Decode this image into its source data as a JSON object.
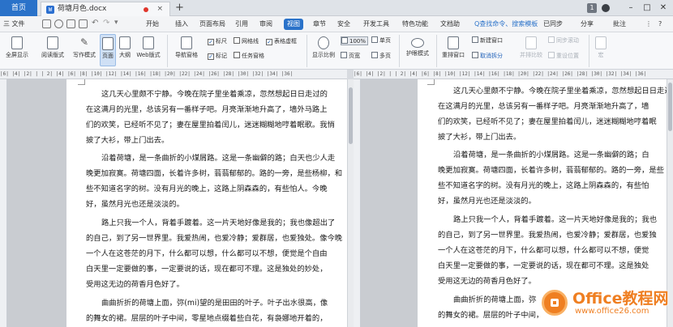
{
  "titlebar": {
    "home_tab": "首页",
    "doc_tab": "荷塘月色.docx",
    "doc_tab_icon": "W",
    "close_glyph": "×",
    "new_tab_glyph": "+",
    "version_badge": "1",
    "minimize_glyph": "–",
    "restore_glyph": "□",
    "close_window_glyph": "✕"
  },
  "menubar": {
    "file_label": "三 文件",
    "items": [
      "开始",
      "插入",
      "页面布局",
      "引用",
      "审阅",
      "视图",
      "章节",
      "安全",
      "开发工具",
      "特色功能",
      "文档助"
    ],
    "active_item": "视图",
    "search_label": "Q查找命令、搜索模板",
    "sync_label": "已同步",
    "share_label": "分享",
    "comment_label": "批注",
    "more_glyph": "⋮",
    "help_glyph": "?"
  },
  "ribbon": {
    "view_buttons": [
      "全屏显示",
      "阅读版式",
      "写作模式",
      "页面",
      "大纲",
      "Web版式"
    ],
    "selected_view": "页面",
    "nav_pane": "导航窗格",
    "checks": [
      {
        "label": "标尺",
        "checked": true
      },
      {
        "label": "网格线",
        "checked": false
      },
      {
        "label": "表格虚框",
        "checked": true
      },
      {
        "label": "标记",
        "checked": true
      },
      {
        "label": "任务窗格",
        "checked": false
      }
    ],
    "zoom_label": "显示比例",
    "zoom_value": "100%",
    "single_page": "单页",
    "page_width": "页宽",
    "multi_page": "多页",
    "eye_mode": "护眼模式",
    "rearrange": "重排窗口",
    "new_window": "新建窗口",
    "cancel_split": "取消拆分",
    "side_by_side": "并排比较",
    "sync_scroll": "同步滚动",
    "reset_position": "重设位置",
    "macro": "宏"
  },
  "ruler": {
    "left_text": "|6| |4| |2| |  | 2| |4| |6| |8| |10| |12| |14| |16| |18| |20| |22| |24| |26| |28| |30| |32| |34| |36|",
    "right_text": "|6| |4| |2| |  | 2| |4| |6| |8| |10| |12| |14| |16| |18| |20| |22| |24| |26| |28| |30| |32| |34| |36|"
  },
  "left_page": {
    "lines": [
      "这几天心里颇不宁静。今晚在院子里坐着乘凉，忽然想起日日走过的",
      "在这满月的光里，总该另有一番样子吧。月亮渐渐地升高了，墙外马路上",
      "们的欢笑，已经听不见了；妻在屋里拍着闰儿，迷迷糊糊地哼着眠歌。我悄",
      "披了大衫，带上门出去。",
      "沿着荷塘，是一条曲折的小煤屑路。这是一条幽僻的路；白天也少人走",
      "晚更加寂寞。荷塘四面，长着许多树，蓊蓊郁郁的。路的一旁，是些杨柳，和",
      "些不知道名字的树。没有月光的晚上，这路上阴森森的，有些怕人。今晚",
      "好，虽然月光也还是淡淡的。",
      "路上只我一个人，背着手踱着。这一片天地好像是我的；我也像超出了",
      "的自己，到了另一世界里。我爱热闹，也爱冷静；爱群居，也爱独处。像今晚",
      "一个人在这苍茫的月下，什么都可以想，什么都可以不想，便觉是个自由",
      "白天里一定要做的事，一定要说的话，现在都可不理。这是独处的妙处，",
      "受用这无边的荷香月色好了。",
      "曲曲折折的荷塘上面，弥(mi)望的是田田的叶子。叶子出水很高，像",
      "的舞女的裙。层层的叶子中间，零星地点缀着些白花，有袅娜地开着的，"
    ]
  },
  "right_page": {
    "lines": [
      "这几天心里颇不宁静。今晚在院子里坐着乘凉，忽然想起日日走过",
      "在这满月的光里，总该另有一番样子吧。月亮渐渐地升高了，墙",
      "们的欢笑，已经听不见了；妻在屋里拍着闰儿，迷迷糊糊地哼着眠",
      "披了大衫，带上门出去。",
      "沿着荷塘，是一条曲折的小煤屑路。这是一条幽僻的路；白",
      "晚更加寂寞。荷塘四面，长着许多树，蓊蓊郁郁的。路的一旁，是些",
      "些不知道名字的树。没有月光的晚上，这路上阴森森的，有些怕",
      "好，虽然月光也还是淡淡的。",
      "路上只我一个人，背着手踱着。这一片天地好像是我的；我也",
      "的自己，到了另一世界里。我爱热闹，也爱冷静；爱群居，也爱独",
      "一个人在这苍茫的月下，什么都可以想，什么都可以不想，便觉",
      "白天里一定要做的事，一定要说的话，现在都可不理。这是独处",
      "受用这无边的荷香月色好了。",
      "曲曲折折的荷塘上面，弥",
      "的舞女的裙。层层的叶子中间，"
    ]
  },
  "watermark": {
    "title": "Office教程网",
    "url": "www.office26.com"
  }
}
